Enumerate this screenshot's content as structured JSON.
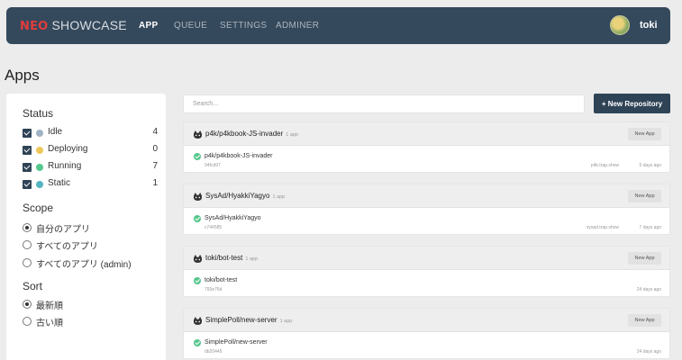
{
  "brand": {
    "neo": "NEO",
    "showcase": "SHOWCASE"
  },
  "nav": {
    "items": [
      "APP",
      "QUEUE",
      "SETTINGS",
      "ADMINER"
    ],
    "active": "APP"
  },
  "user": {
    "name": "toki"
  },
  "page": {
    "title": "Apps"
  },
  "filters": {
    "status_title": "Status",
    "status": [
      {
        "label": "Idle",
        "count": "4",
        "checked": true,
        "color": "#9fb3c4"
      },
      {
        "label": "Deploying",
        "count": "0",
        "checked": true,
        "color": "#f0c85a"
      },
      {
        "label": "Running",
        "count": "7",
        "checked": true,
        "color": "#55c78c"
      },
      {
        "label": "Static",
        "count": "1",
        "checked": true,
        "color": "#54b4c2"
      }
    ],
    "scope_title": "Scope",
    "scope": [
      {
        "label": "自分のアプリ",
        "selected": true
      },
      {
        "label": "すべてのアプリ",
        "selected": false
      },
      {
        "label": "すべてのアプリ (admin)",
        "selected": false
      }
    ],
    "sort_title": "Sort",
    "sort": [
      {
        "label": "最新順",
        "selected": true
      },
      {
        "label": "古い順",
        "selected": false
      }
    ]
  },
  "search": {
    "placeholder": "Search..."
  },
  "new_repo_button": "+ New Repository",
  "new_app_label": "New App",
  "repositories": [
    {
      "name": "p4k/p4kbook-JS-invader",
      "app_count": "1 app",
      "app": {
        "name": "p4k/p4kbook-JS-invader",
        "hash": "94fcd97",
        "domain": "p4k.trap.show",
        "time": "5 days ago"
      }
    },
    {
      "name": "SysAd/HyakkiYagyo",
      "app_count": "1 app",
      "app": {
        "name": "SysAd/HyakkiYagyo",
        "hash": "c744585",
        "domain": "sysad.trap.show",
        "time": "7 days ago"
      }
    },
    {
      "name": "toki/bot-test",
      "app_count": "1 app",
      "app": {
        "name": "toki/bot-test",
        "hash": "793e76d",
        "domain": "",
        "time": "24 days ago"
      }
    },
    {
      "name": "SimplePoll/new-server",
      "app_count": "1 app",
      "app": {
        "name": "SimplePoll/new-server",
        "hash": "db20445",
        "domain": "",
        "time": "24 days ago"
      }
    }
  ],
  "colors": {
    "navbar": "#35495c",
    "accent": "#2f4356",
    "brand_red": "#e23c3c",
    "running": "#55c78c"
  }
}
